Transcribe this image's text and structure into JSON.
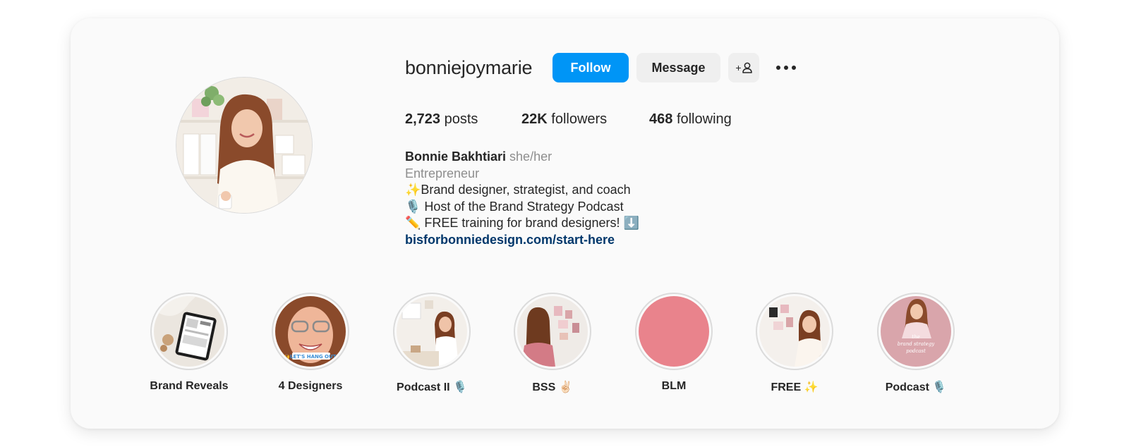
{
  "profile": {
    "username": "bonniejoymarie",
    "follow_label": "Follow",
    "message_label": "Message",
    "add_user_glyph": "+",
    "more_glyph": "•••"
  },
  "stats": {
    "posts_count": "2,723",
    "posts_label": "posts",
    "followers_count": "22K",
    "followers_label": "followers",
    "following_count": "468",
    "following_label": "following"
  },
  "bio": {
    "name": "Bonnie Bakhtiari",
    "pronouns": "she/her",
    "category": "Entrepreneur",
    "lines": [
      "✨Brand designer, strategist, and coach",
      "🎙️ Host of the Brand Strategy Podcast",
      "✏️ FREE training for brand designers! ⬇️"
    ],
    "link": "bisforbonniedesign.com/start-here"
  },
  "highlights": [
    {
      "label": "Brand Reveals",
      "icon": "tablet-mockup-image"
    },
    {
      "label": "4 Designers",
      "icon": "selfie-image",
      "sticker": "🙌LET'S HANG OUT!"
    },
    {
      "label": "Podcast II 🎙️",
      "icon": "podcast-desk-image"
    },
    {
      "label": "BSS ✌🏻",
      "icon": "moodboard-image"
    },
    {
      "label": "BLM",
      "icon": "solid-color-circle",
      "color": "#e9838c"
    },
    {
      "label": "FREE ✨",
      "icon": "wall-pinning-image"
    },
    {
      "label": "Podcast 🎙️",
      "icon": "podcast-cover-image",
      "cover_text": [
        "the",
        "brand strategy",
        "podcast"
      ]
    }
  ],
  "colors": {
    "accent": "#0095f6",
    "link": "#00376b",
    "muted": "#8e8e8e",
    "button_bg": "#efefef"
  }
}
